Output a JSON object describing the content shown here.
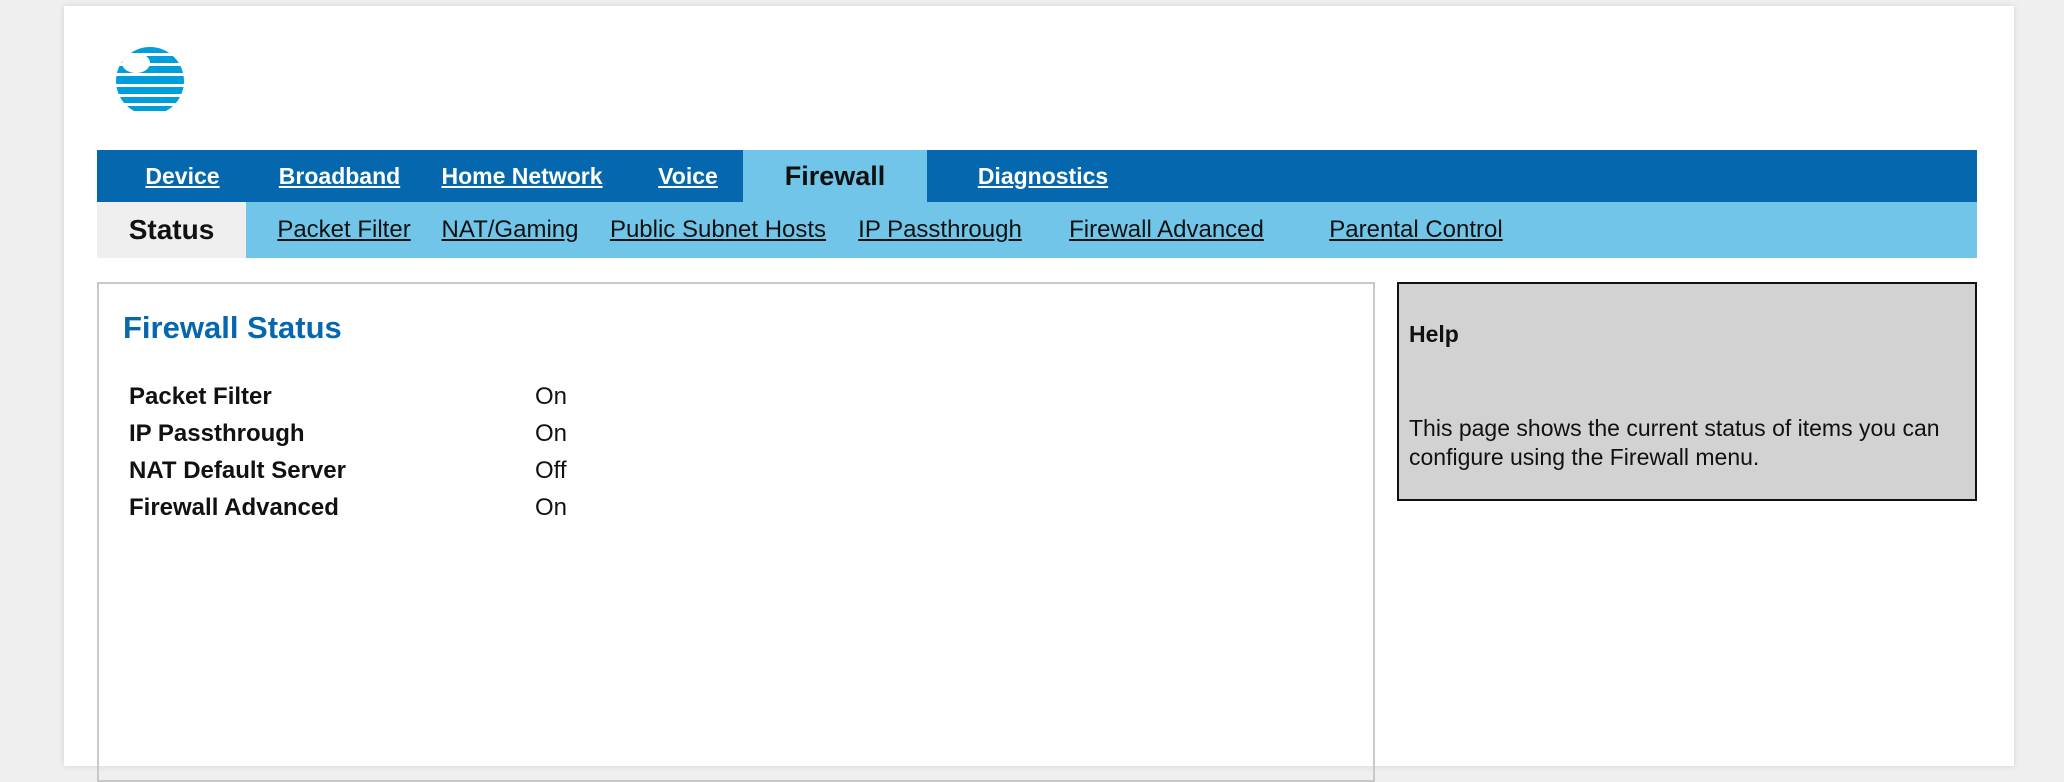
{
  "brand": {
    "logo_icon": "att-globe-icon",
    "accent": "#0568ae",
    "light_accent": "#71c5e8"
  },
  "topnav": {
    "items": [
      {
        "label": "Device"
      },
      {
        "label": "Broadband"
      },
      {
        "label": "Home Network"
      },
      {
        "label": "Voice"
      },
      {
        "label": "Firewall",
        "active": true
      },
      {
        "label": "Diagnostics"
      }
    ]
  },
  "subnav": {
    "items": [
      {
        "label": "Status",
        "active": true
      },
      {
        "label": "Packet Filter"
      },
      {
        "label": "NAT/Gaming"
      },
      {
        "label": "Public Subnet Hosts"
      },
      {
        "label": "IP Passthrough"
      },
      {
        "label": "Firewall Advanced"
      },
      {
        "label": "Parental Control"
      }
    ]
  },
  "main": {
    "title": "Firewall Status",
    "rows": [
      {
        "label": "Packet Filter",
        "value": "On"
      },
      {
        "label": "IP Passthrough",
        "value": "On"
      },
      {
        "label": "NAT Default Server",
        "value": "Off"
      },
      {
        "label": "Firewall Advanced",
        "value": "On"
      }
    ]
  },
  "help": {
    "title": "Help",
    "text": "This page shows the current status of items you can configure using the Firewall menu."
  }
}
